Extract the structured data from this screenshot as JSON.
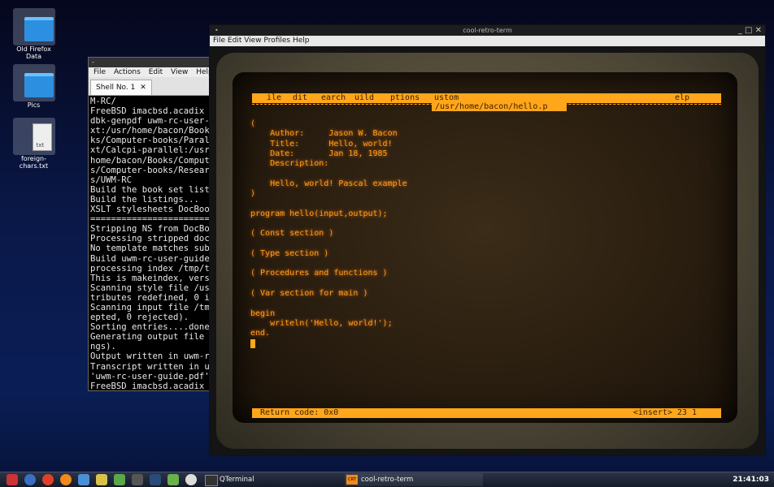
{
  "desktop": {
    "icons": [
      {
        "label": "Old Firefox Data",
        "type": "folder-icon"
      },
      {
        "label": "Pics",
        "type": "folder-icon"
      },
      {
        "label": "foreign-chars.txt",
        "type": "text-file-icon",
        "badge": "txt"
      }
    ]
  },
  "qterminal": {
    "title": "-",
    "menu": [
      "File",
      "Actions",
      "Edit",
      "View",
      "Help"
    ],
    "tab_label": "Shell No. 1",
    "lines": [
      "M-RC/",
      "FreeBSD imacbsd.acadix",
      "dbk-genpdf uwm-rc-user-",
      "xt:/usr/home/bacon/Book",
      "ks/Computer-books/Paral",
      "xt/Calcpi-parallel:/usr",
      "home/bacon/Books/Comput",
      "s/Computer-books/Resear",
      "s/UWM-RC",
      "Build the book set list",
      "Build the listings...",
      "XSLT stylesheets DocBoo",
      "========================",
      "Stripping NS from DocBo",
      "Processing stripped doc",
      "No template matches sub",
      "Build uwm-rc-user-guide",
      "processing index /tmp/t",
      "This is makeindex, vers",
      "Scanning style file /us",
      "tributes redefined, 0 i",
      "Scanning input file /tm",
      "epted, 0 rejected).",
      "Sorting entries....done",
      "Generating output file",
      "ngs).",
      "Output written in uwm-r",
      "Transcript written in u",
      "'uwm-rc-user-guide.pdf'",
      "FreeBSD imacbsd.acadix"
    ]
  },
  "crt": {
    "title": "cool-retro-term",
    "window_dot": "•",
    "window_controls": "_ □ ✕",
    "menu": "File Edit View Profiles Help",
    "editor_menu": [
      "File",
      "Edit",
      "Search",
      "Build",
      "Options",
      "Custom",
      "Help"
    ],
    "editor_menu_visible": [
      "ile",
      "dit",
      "earch",
      "uild",
      "ptions",
      "ustom",
      "elp"
    ],
    "file_path": "/usr/home/bacon/hello.p",
    "code_lines": [
      "(",
      "    Author:     Jason W. Bacon",
      "    Title:      Hello, world!",
      "    Date:       Jan 18, 1985",
      "    Description:",
      "",
      "    Hello, world! Pascal example",
      ")",
      "",
      "program hello(input,output);",
      "",
      "( Const section )",
      "",
      "( Type section )",
      "",
      "( Procedures and functions )",
      "",
      "( Var section for main )",
      "",
      "begin",
      "    writeln('Hello, world!');",
      "end."
    ],
    "status_left": "Return code: 0x0",
    "status_right": "<insert>  23 1"
  },
  "taskbar": {
    "tasks": [
      {
        "label": "QTerminal",
        "icon": "terminal-icon"
      },
      {
        "label": "cool-retro-term",
        "icon": "crt-icon",
        "badge": "CRT"
      }
    ],
    "clock": "21:41:03"
  }
}
